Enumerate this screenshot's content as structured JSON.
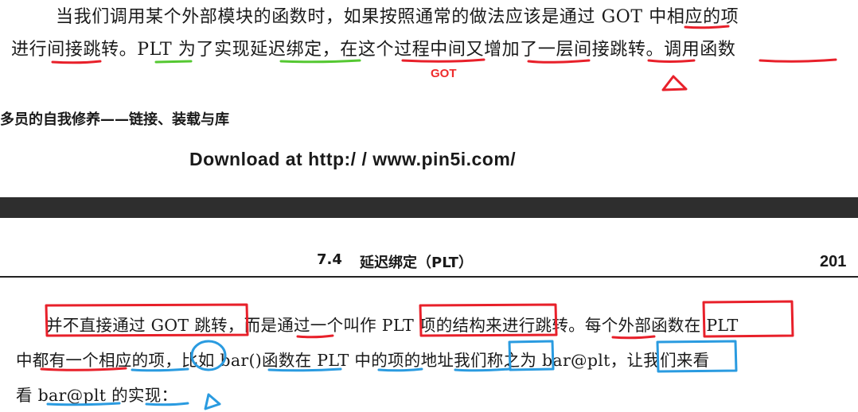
{
  "top_excerpt": {
    "line1": "当我们调用某个外部模块的函数时，如果按照通常的做法应该是通过 GOT 中相应的项",
    "line2": "进行间接跳转。PLT 为了实现延迟绑定，在这个过程中间又增加了一层间接跳转。调用函数",
    "annotation_label": "GOT"
  },
  "book_title_fragment": "多员的自我修养——链接、装载与库",
  "download_notice": "Download at http:/ / www.pin5i.com/",
  "page_header": {
    "section": "7.4",
    "title": "延迟绑定（PLT）",
    "page_number": "201"
  },
  "body_text": {
    "line1": "并不直接通过 GOT 跳转，而是通过一个叫作 PLT 项的结构来进行跳转。每个外部函数在 PLT",
    "line2": "中都有一个相应的项，比如 bar()函数在 PLT 中的项的地址我们称之为 bar@plt，让我们来看",
    "line3": "看 bar@plt 的实现："
  },
  "annotation_colors": {
    "red": "#e8202a",
    "green": "#55c832",
    "blue": "#2a9be0"
  }
}
